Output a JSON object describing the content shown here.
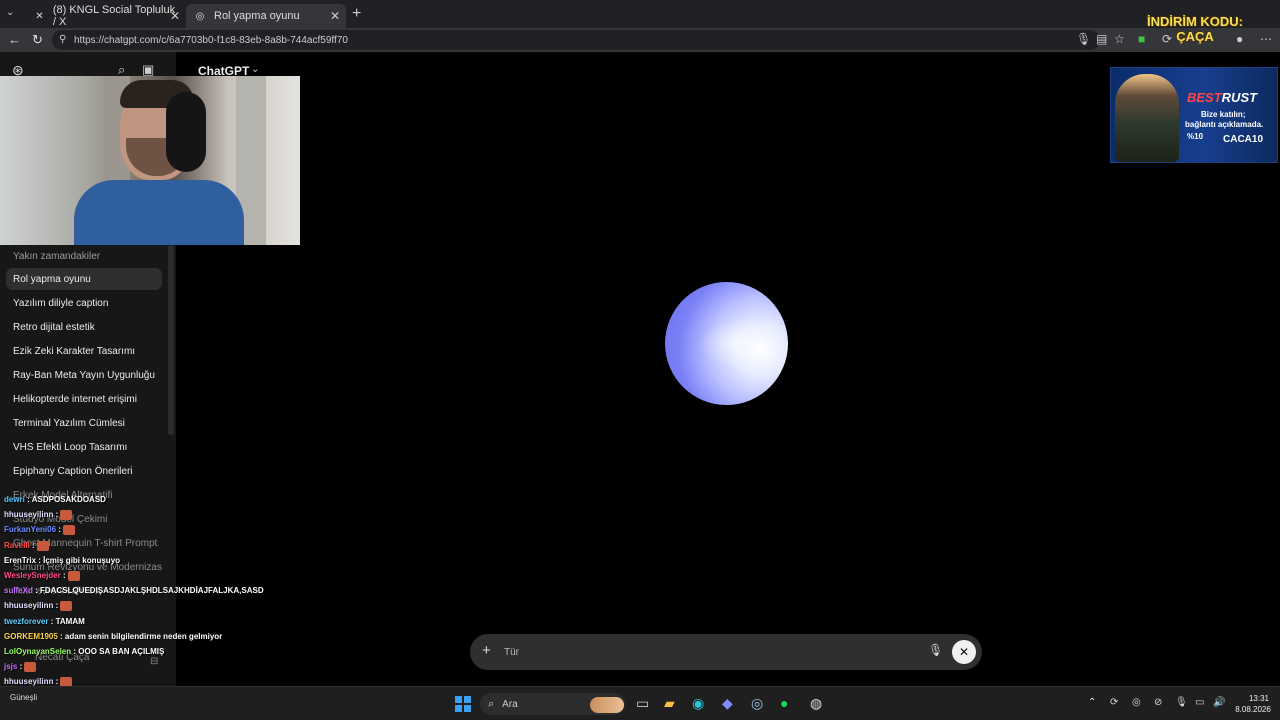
{
  "browser": {
    "tabs": [
      {
        "title": "(8) KNGL Social Topluluk / X",
        "icon": "x-logo-icon"
      },
      {
        "title": "Rol yapma oyunu",
        "icon": "openai-icon",
        "active": true
      }
    ],
    "url": "https://chatgpt.com/c/6a7703b0-f1c8-83eb-8a8b-744acf59ff70"
  },
  "overlay": {
    "promo_line1": "İNDİRİM KODU:",
    "promo_line2": "ÇAÇA"
  },
  "app": {
    "model_title": "ChatGPT",
    "recents_header": "Yakın zamandakiler",
    "conversations": [
      {
        "label": "Rol yapma oyunu",
        "active": true
      },
      {
        "label": "Yazılım diliyle caption"
      },
      {
        "label": "Retro dijital estetik"
      },
      {
        "label": "Ezik Zeki Karakter Tasarımı"
      },
      {
        "label": "Ray-Ban Meta Yayın Uygunluğu"
      },
      {
        "label": "Helikopterde internet erişimi"
      },
      {
        "label": "Terminal Yazılım Cümlesi"
      },
      {
        "label": "VHS Efekti Loop Tasarımı"
      },
      {
        "label": "Epiphany Caption Önerileri"
      },
      {
        "label": "Erkek Model Alternatifi",
        "dim": true
      },
      {
        "label": "Stüdyo Model Çekimi",
        "dim": true
      },
      {
        "label": "Ghost Mannequin T-shirt Prompt",
        "dim": true
      },
      {
        "label": "Sunum Revizyonu ve Modernizasy",
        "dim": true
      },
      {
        "label": "Rust evreni sahnesi",
        "dim": true
      }
    ],
    "profile_name": "Necati Çaça",
    "composer_placeholder": "Tür"
  },
  "chat_lines": [
    {
      "user": "dewri",
      "msg": "ASDPOSAKDOASD",
      "color": "#53c8ff"
    },
    {
      "user": "hhuuseyilinn",
      "msg": "",
      "color": "#e0e0ff"
    },
    {
      "user": "FurkanYeni06",
      "msg": "",
      "color": "#6b8cff"
    },
    {
      "user": "RaveIII",
      "msg": "",
      "color": "#ff4a4a"
    },
    {
      "user": "ErenTrix",
      "msg": "İçmiş gibi konuşuyo",
      "color": "#ffffff"
    },
    {
      "user": "WesleySnejder",
      "msg": "",
      "color": "#ff4a86"
    },
    {
      "user": "sulfeXd",
      "msg": "FDACSLQUEDIŞASDJAKLŞHDLSAJKHDİAJFALJKA,SASD",
      "color": "#c46bff"
    },
    {
      "user": "hhuuseyilinn",
      "msg": "",
      "color": "#e0e0ff"
    },
    {
      "user": "twezforever",
      "msg": "TAMAM",
      "color": "#58d0ff"
    },
    {
      "user": "GORKEM1905",
      "msg": "adam senin bilgilendirme neden gelmiyor",
      "color": "#ffd34a"
    },
    {
      "user": "LolOynayanSelen",
      "msg": "OOO SA BAN AÇILMIŞ",
      "color": "#9bff6b"
    },
    {
      "user": "jsjs",
      "msg": "",
      "color": "#c46bff"
    },
    {
      "user": "hhuuseyilinn",
      "msg": "",
      "color": "#e0e0ff"
    },
    {
      "user": "twezforever",
      "msg": "HERSEYEDE TAMAM AMK",
      "color": "#58d0ff"
    }
  ],
  "ad": {
    "brand_a": "BEST",
    "brand_b": "RUST",
    "line1": "Bize katılın;",
    "line2": "bağlantı açıklamada.",
    "discount": "%10",
    "code": "CACA10"
  },
  "taskbar": {
    "search_label": "Ara",
    "weather": "Güneşli",
    "time": "13:31",
    "date": "8.08.2026"
  }
}
